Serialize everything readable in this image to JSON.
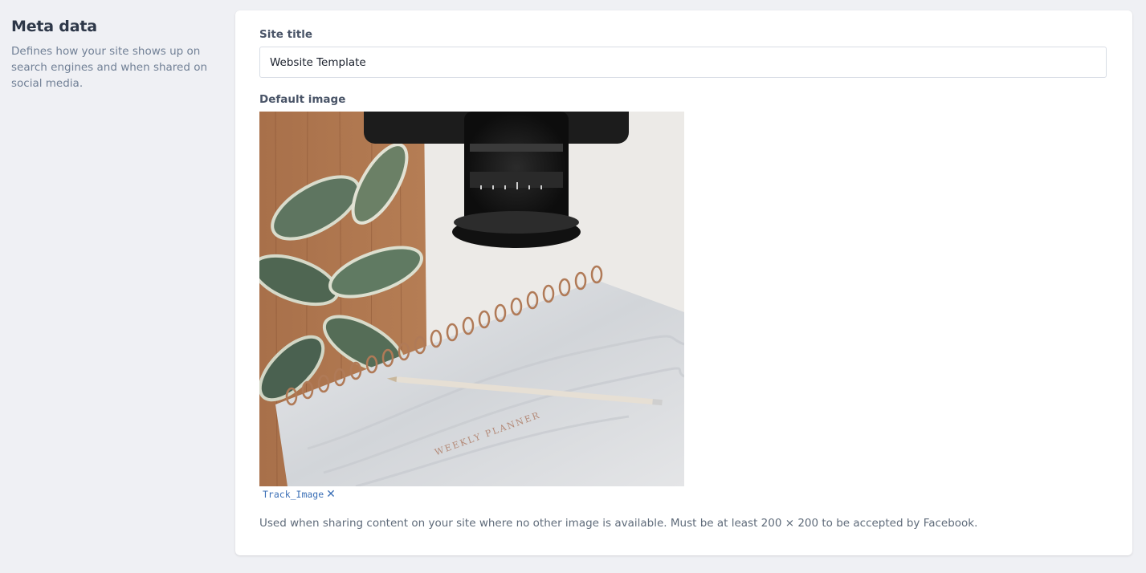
{
  "section": {
    "title": "Meta data",
    "description": "Defines how your site shows up on search engines and when shared on social media."
  },
  "site_title": {
    "label": "Site title",
    "value": "Website Template"
  },
  "default_image": {
    "label": "Default image",
    "file_name": "Track_Image",
    "remove_icon": "close-icon",
    "notebook_text": "WEEKLY PLANNER",
    "help_text": "Used when sharing content on your site where no other image is available. Must be at least 200 × 200 to be accepted by Facebook."
  },
  "colors": {
    "background": "#eff0f4",
    "card": "#ffffff",
    "link": "#3b6fb6"
  }
}
